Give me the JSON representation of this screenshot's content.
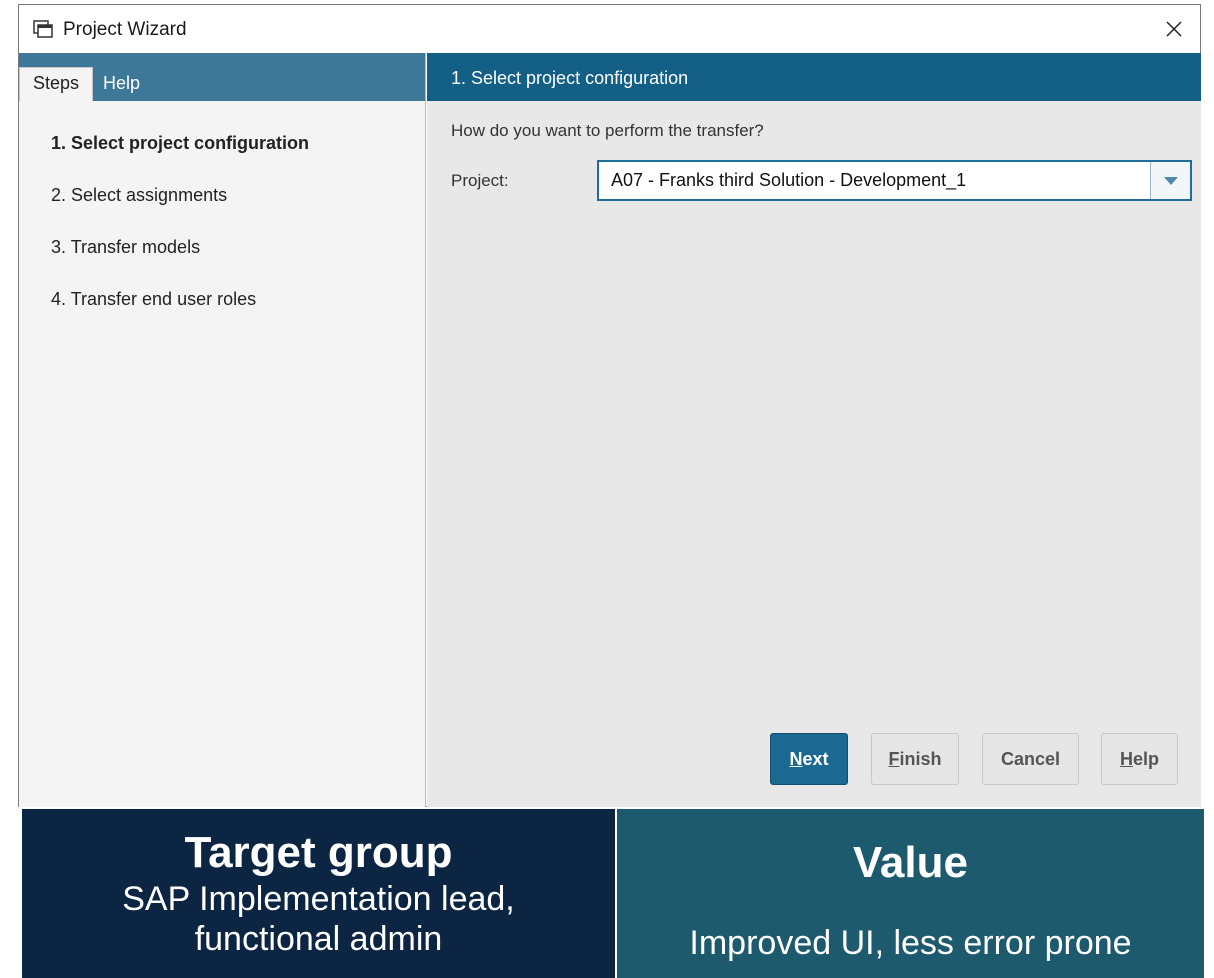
{
  "window": {
    "title": "Project Wizard",
    "icon": "window-icon",
    "close_icon": "close-icon"
  },
  "sidebar": {
    "tabs": [
      {
        "label": "Steps",
        "active": true
      },
      {
        "label": "Help",
        "active": false
      }
    ],
    "steps": [
      {
        "label": "1. Select project configuration",
        "active": true
      },
      {
        "label": "2. Select assignments",
        "active": false
      },
      {
        "label": "3. Transfer models",
        "active": false
      },
      {
        "label": "4. Transfer end user roles",
        "active": false
      }
    ]
  },
  "main": {
    "header_title": "1. Select project configuration",
    "question": "How do you want to perform the transfer?",
    "project_label": "Project:",
    "project_value": "A07 - Franks third Solution - Development_1"
  },
  "buttons": {
    "next": {
      "mnemonic": "N",
      "rest": "ext"
    },
    "finish": {
      "mnemonic": "F",
      "rest": "inish"
    },
    "cancel": {
      "label": "Cancel"
    },
    "help": {
      "mnemonic": "H",
      "rest": "elp"
    }
  },
  "info_panels": {
    "target": {
      "heading": "Target group",
      "line1": "SAP Implementation lead,",
      "line2": "functional admin"
    },
    "value": {
      "heading": "Value",
      "text": "Improved UI, less error prone"
    }
  },
  "colors": {
    "header_bar": "#145f85",
    "tab_bar": "#3e7898",
    "primary_button": "#1b6990",
    "panel_left": "#0b2542",
    "panel_right": "#1d5a6e"
  }
}
